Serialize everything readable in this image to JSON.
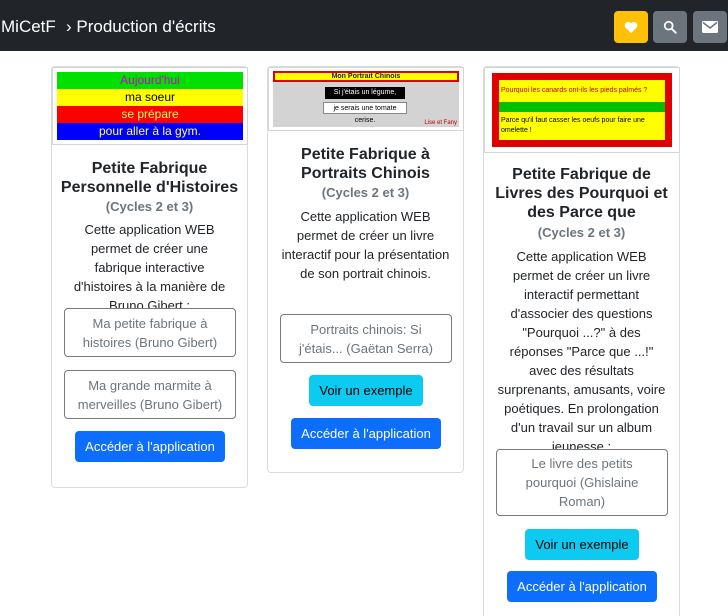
{
  "navbar": {
    "brand": "MiCetF",
    "breadcrumb": "› Production d'écrits",
    "buttons": [
      {
        "icon": "heart-icon",
        "color": "#ffc107"
      },
      {
        "icon": "search-icon",
        "color": "#6c757d"
      },
      {
        "icon": "mail-icon",
        "color": "#6c757d"
      }
    ]
  },
  "cards": [
    {
      "title": "Petite Fabrique Personnelle d'Histoires",
      "cycles": "(Cycles 2 et 3)",
      "description": "Cette application WEB permet de créer une fabrique interactive d'histoires à la manière de Bruno Gibert :",
      "books": [
        "Ma petite fabrique à histoires (Bruno Gibert)",
        "Ma grande marmite à merveilles (Bruno Gibert)"
      ],
      "app_button": "Accéder à l'application",
      "thumbnail": {
        "lines": [
          "Aujourd'hui",
          "ma soeur",
          "se prépare",
          "pour aller à la gym."
        ]
      }
    },
    {
      "title": "Petite Fabrique à Portraits Chinois",
      "cycles": "(Cycles 2 et 3)",
      "description": "Cette application WEB permet de créer un livre interactif pour la présentation de son portrait chinois.",
      "books": [
        "Portraits chinois: Si j'étais... (Gaëtan Serra)"
      ],
      "example_button": "Voir un exemple",
      "app_button": "Accéder à l'application",
      "thumbnail": {
        "header": "Mon Portrait Chinois",
        "line1": "Si j'étais un légume,",
        "line2": "je serais une tomate cerise.",
        "signature": "Lise et Fany"
      }
    },
    {
      "title": "Petite Fabrique de Livres des Pourquoi et des Parce que",
      "cycles": "(Cycles 2 et 3)",
      "description": "Cette application WEB permet de créer un livre interactif permettant d'associer des questions \"Pourquoi ...?\" à des réponses \"Parce que ...!\" avec des résultats surprenants, amusants, voire poétiques. En prolongation d'un travail sur un album jeunesse :",
      "books": [
        "Le livre des petits pourquoi (Ghislaine Roman)"
      ],
      "example_button": "Voir un exemple",
      "app_button": "Accéder à l'application",
      "thumbnail": {
        "question": "Pourquoi les canards ont-ils les pieds palmés ?",
        "answer": "Parce qu'il faut casser les oeufs pour faire une omelette !"
      }
    }
  ],
  "colors": {
    "navbar_bg": "#212529",
    "primary": "#0d6efd",
    "info": "#0dcaf0",
    "warning": "#ffc107",
    "secondary": "#6c757d"
  }
}
